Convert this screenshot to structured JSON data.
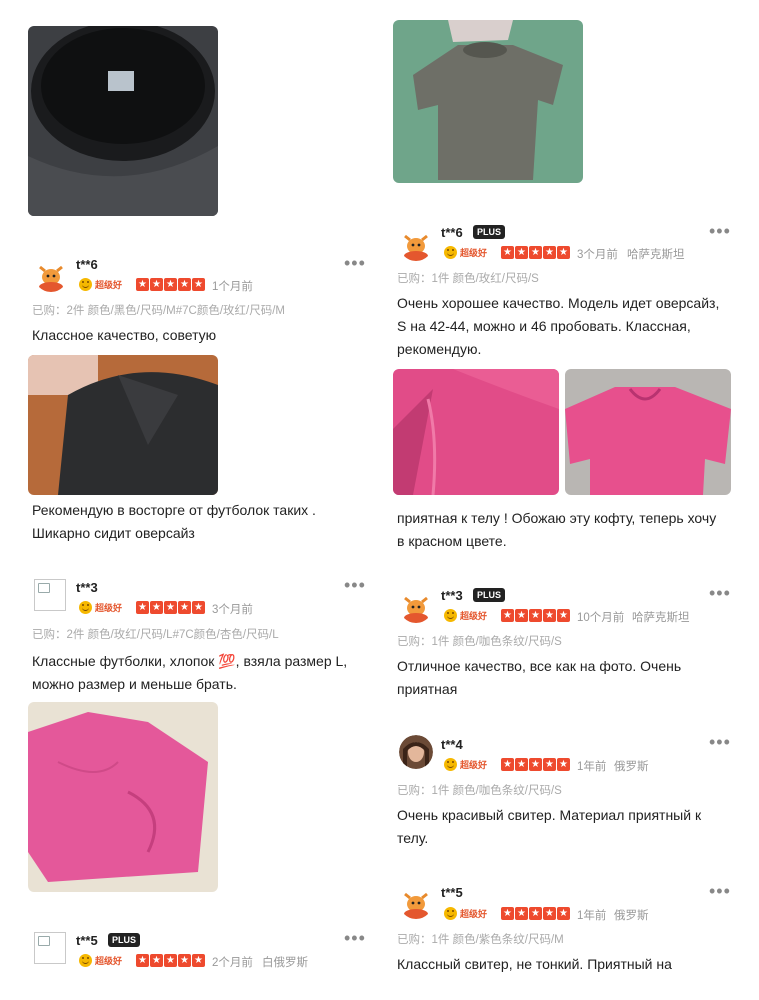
{
  "badge_label": "超级好",
  "plus_label": "PLUS",
  "more_label": "•••",
  "left": {
    "r1": {
      "user": "t**6",
      "date": "1个月前",
      "purchase": "已购：2件  颜色/黑色/尺码/M#7C颜色/玫红/尺码/M",
      "text1": "Классное качество, советую",
      "text2": "Рекомендую в восторге от футболок таких .",
      "text3": "Шикарно сидит оверсайз"
    },
    "r2": {
      "user": "t**3",
      "date": "3个月前",
      "purchase": "已购：2件  颜色/玫红/尺码/L#7C颜色/杏色/尺码/L",
      "text1": "Классные футболки, хлопок 💯, взяла размер L,",
      "text2": "можно размер и меньше брать."
    },
    "r3": {
      "user": "t**5",
      "date": "2个月前",
      "region": "白俄罗斯"
    }
  },
  "right": {
    "r1": {
      "user": "t**6",
      "date": "3个月前",
      "region": "哈萨克斯坦",
      "purchase": "已购：1件  颜色/玫红/尺码/S",
      "text1": "Очень хорошее качество. Модель идет оверсайз,",
      "text2": "S на 42-44, можно и 46 пробовать. Классная,",
      "text3": "рекомендую.",
      "text4": "приятная к телу ! Обожаю эту кофту, теперь хочу",
      "text5": "в красном цвете."
    },
    "r2": {
      "user": "t**3",
      "date": "10个月前",
      "region": "哈萨克斯坦",
      "purchase": "已购：1件  颜色/咖色条纹/尺码/S",
      "text1": "Отличное качество, все как на фото. Очень",
      "text2": "приятная"
    },
    "r3": {
      "user": "t**4",
      "date": "1年前",
      "region": "俄罗斯",
      "purchase": "已购：1件  颜色/咖色条纹/尺码/S",
      "text1": "Очень красивый свитер. Материал приятный к",
      "text2": "телу."
    },
    "r4": {
      "user": "t**5",
      "date": "1年前",
      "region": "俄罗斯",
      "purchase": "已购：1件  颜色/紫色条纹/尺码/M",
      "text1": "Классный свитер, не тонкий. Приятный на"
    }
  }
}
